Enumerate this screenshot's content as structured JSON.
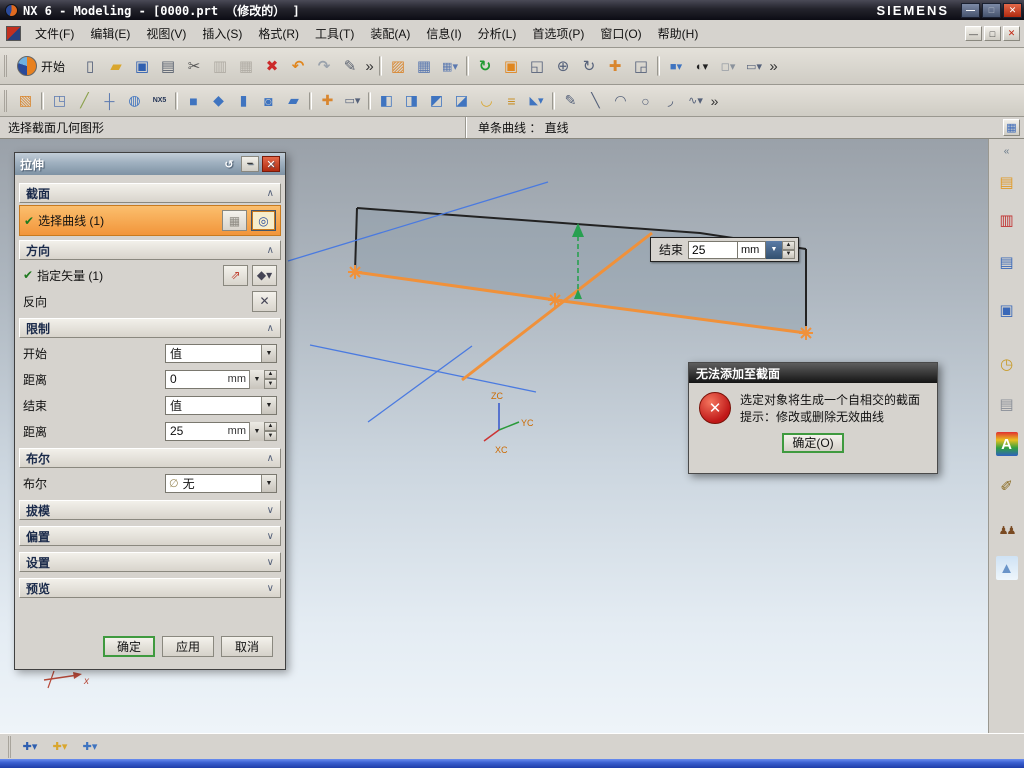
{
  "titlebar": {
    "title": "NX 6 - Modeling - [0000.prt （修改的） ]",
    "brand": "SIEMENS"
  },
  "window_buttons": {
    "min": "—",
    "max": "□",
    "close": "✕"
  },
  "glyphs": {
    "down": "▼",
    "up": "▲",
    "chev_up": "∧",
    "chev_down": "∨",
    "check": "✔",
    "reset": "↺",
    "minus": "−",
    "close": "✕",
    "loop": "◎",
    "vector_dialog": "⇗",
    "vector_list": "◆▾",
    "reverse": "✕",
    "deselect": "▦",
    "none_icon": "∅",
    "prompt_btn": "▦",
    "error_x": "✕"
  },
  "menubar": {
    "items": [
      "文件(F)",
      "编辑(E)",
      "视图(V)",
      "插入(S)",
      "格式(R)",
      "工具(T)",
      "装配(A)",
      "信息(I)",
      "分析(L)",
      "首选项(P)",
      "窗口(O)",
      "帮助(H)"
    ]
  },
  "toolbar1": {
    "start_label": "开始",
    "icons": [
      {
        "name": "new-file-icon",
        "g": "▯",
        "style": "color:#55617a"
      },
      {
        "name": "open-folder-icon",
        "g": "▰",
        "style": "color:#d9a62e"
      },
      {
        "name": "save-icon",
        "g": "▣",
        "style": "color:#2f5fb0"
      },
      {
        "name": "print-icon",
        "g": "▤",
        "style": "color:#5a6270"
      },
      {
        "name": "cut-icon",
        "g": "✂",
        "style": "color:#555555"
      },
      {
        "name": "copy-icon",
        "g": "▥",
        "style": "color:#b0aca4"
      },
      {
        "name": "paste-icon",
        "g": "▦",
        "style": "color:#b0aca4"
      },
      {
        "name": "delete-icon",
        "g": "✖",
        "style": "color:#cc2a2a"
      },
      {
        "name": "undo-icon",
        "g": "↶",
        "style": "color:#e0861e;font-weight:bold"
      },
      {
        "name": "redo-icon",
        "g": "↷",
        "style": "color:#9aa2ac;font-weight:bold"
      },
      {
        "name": "pen-icon",
        "g": "✎",
        "style": "color:#5a6270"
      },
      {
        "name": "overflow-chevron-icon",
        "g": "»",
        "style": "color:#333333;width:11px"
      },
      {
        "name": "toolbar-separator",
        "g": "",
        "style": "width:3px;height:20px;margin:0 3px;border-left:1px solid #9a9890;border-right:1px solid #ffffff",
        "it": "false"
      },
      {
        "name": "sketch-task-icon",
        "g": "▨",
        "style": "color:#d9862e"
      },
      {
        "name": "datum-grid-icon",
        "g": "▦",
        "style": "color:#5b79b0"
      },
      {
        "name": "csys-grid-icon",
        "g": "▦▾",
        "style": "color:#5b79b0;font-size:11px"
      },
      {
        "name": "toolbar-separator",
        "g": "",
        "style": "width:3px;height:20px;margin:0 3px;border-left:1px solid #9a9890;border-right:1px solid #ffffff",
        "it": "false"
      },
      {
        "name": "refresh-icon",
        "g": "↻",
        "style": "color:#1f9a2f;font-weight:bold"
      },
      {
        "name": "fit-view-icon",
        "g": "▣",
        "style": "color:#e0861e"
      },
      {
        "name": "zoom-box-icon",
        "g": "◱",
        "style": "color:#55617a"
      },
      {
        "name": "zoom-in-out-icon",
        "g": "⊕",
        "style": "color:#55617a"
      },
      {
        "name": "rotate-view-icon",
        "g": "↻",
        "style": "color:#55617a"
      },
      {
        "name": "pan-view-icon",
        "g": "✚",
        "style": "color:#d9862e"
      },
      {
        "name": "snapshot-icon",
        "g": "◲",
        "style": "color:#55617a"
      },
      {
        "name": "toolbar-separator",
        "g": "",
        "style": "width:3px;height:20px;margin:0 3px;border-left:1px solid #9a9890;border-right:1px solid #ffffff",
        "it": "false"
      },
      {
        "name": "shaded-view-icon",
        "g": "■▾",
        "style": "color:#3f74c0;font-size:11px"
      },
      {
        "name": "render-style-icon",
        "g": "◐▾",
        "style": "color:#222222;font-size:11px"
      },
      {
        "name": "background-icon",
        "g": "◻▾",
        "style": "color:#8a929c;font-size:11px"
      },
      {
        "name": "window-display-icon",
        "g": "▭▾",
        "style": "color:#55617a;font-size:11px"
      },
      {
        "name": "overflow-chevron-icon",
        "g": "»",
        "style": "color:#333333;width:11px"
      }
    ]
  },
  "toolbar2": {
    "icons": [
      {
        "name": "direct-sketch-icon",
        "g": "▧",
        "style": "color:#d9862e"
      },
      {
        "name": "toolbar-separator",
        "g": "",
        "style": "width:3px;height:18px;margin:0 3px;border-left:1px solid #9a9890;border-right:1px solid #ffffff",
        "it": "false"
      },
      {
        "name": "datum-plane-icon",
        "g": "◳",
        "style": "color:#5b79b0"
      },
      {
        "name": "datum-axis-icon",
        "g": "╱",
        "style": "color:#8aa04a"
      },
      {
        "name": "datum-csys-icon",
        "g": "┼",
        "style": "color:#5b79b0"
      },
      {
        "name": "cylinder-icon",
        "g": "◍",
        "style": "color:#3f74c0"
      },
      {
        "name": "nx5-sketch-icon",
        "g": "NX5",
        "style": "color:#223355;font-size:7px;font-weight:bold"
      },
      {
        "name": "toolbar-separator",
        "g": "",
        "style": "width:3px;height:18px;margin:0 3px;border-left:1px solid #9a9890;border-right:1px solid #ffffff",
        "it": "false"
      },
      {
        "name": "extrude-icon",
        "g": "■",
        "style": "color:#3f74c0"
      },
      {
        "name": "revolve-icon",
        "g": "◆",
        "style": "color:#3f74c0"
      },
      {
        "name": "block-icon",
        "g": "▮",
        "style": "color:#3f74c0"
      },
      {
        "name": "hole-icon",
        "g": "◙",
        "style": "color:#3f74c0"
      },
      {
        "name": "boss-icon",
        "g": "▰",
        "style": "color:#3f74c0"
      },
      {
        "name": "toolbar-separator",
        "g": "",
        "style": "width:3px;height:18px;margin:0 3px;border-left:1px solid #9a9890;border-right:1px solid #ffffff",
        "it": "false"
      },
      {
        "name": "point-icon",
        "g": "✚",
        "style": "color:#d9862e"
      },
      {
        "name": "rectangle-icon",
        "g": "▭▾",
        "style": "color:#55617a;font-size:11px"
      },
      {
        "name": "toolbar-separator",
        "g": "",
        "style": "width:3px;height:18px;margin:0 3px;border-left:1px solid #9a9890;border-right:1px solid #ffffff",
        "it": "false"
      },
      {
        "name": "unite-icon",
        "g": "◧",
        "style": "color:#3f74c0"
      },
      {
        "name": "subtract-icon",
        "g": "◨",
        "style": "color:#3f74c0"
      },
      {
        "name": "intersect-icon",
        "g": "◩",
        "style": "color:#3f74c0"
      },
      {
        "name": "trim-body-icon",
        "g": "◪",
        "style": "color:#3f74c0"
      },
      {
        "name": "shell-icon",
        "g": "◡",
        "style": "color:#d9a62e;font-weight:bold"
      },
      {
        "name": "thread-icon",
        "g": "≡",
        "style": "color:#c89028"
      },
      {
        "name": "chamfer-icon",
        "g": "◣▾",
        "style": "color:#3f74c0;font-size:11px"
      },
      {
        "name": "toolbar-separator",
        "g": "",
        "style": "width:3px;height:18px;margin:0 3px;border-left:1px solid #9a9890;border-right:1px solid #ffffff",
        "it": "false"
      },
      {
        "name": "profile-icon",
        "g": "✎",
        "style": "color:#55617a"
      },
      {
        "name": "line-icon",
        "g": "╲",
        "style": "color:#55617a"
      },
      {
        "name": "arc-icon",
        "g": "◠",
        "style": "color:#55617a"
      },
      {
        "name": "circle-icon",
        "g": "○",
        "style": "color:#55617a"
      },
      {
        "name": "fillet-icon",
        "g": "◞",
        "style": "color:#55617a"
      },
      {
        "name": "spline-icon",
        "g": "∿▾",
        "style": "color:#55617a;font-size:11px"
      },
      {
        "name": "overflow-chevron-icon",
        "g": "»",
        "style": "color:#333333;width:11px"
      }
    ]
  },
  "promptbar": {
    "message": "选择截面几何图形",
    "filter": "单条曲线 ： 直线"
  },
  "dialog": {
    "title": "拉伸",
    "section_header": "截面",
    "select_curve": "选择曲线 (1)",
    "direction_header": "方向",
    "specify_vector": "指定矢量 (1)",
    "reverse_label": "反向",
    "limits_header": "限制",
    "start_label": "开始",
    "end_label": "结束",
    "distance_label": "距离",
    "value_option": "值",
    "start_distance": "0",
    "end_distance": "25",
    "unit": "mm",
    "boolean_header": "布尔",
    "boolean_label": "布尔",
    "boolean_value": "无",
    "draft_header": "拔模",
    "offset_header": "偏置",
    "settings_header": "设置",
    "preview_header": "预览",
    "ok": "确定",
    "apply": "应用",
    "cancel": "取消"
  },
  "floating": {
    "label": "结束",
    "value": "25",
    "unit": "mm"
  },
  "error_dialog": {
    "title": "无法添加至截面",
    "line1": "选定对象将生成一个自相交的截面",
    "line2": "提示：修改或删除无效曲线",
    "ok": "确定(O)"
  },
  "graphics": {
    "zc": "ZC",
    "yc": "YC",
    "xc": "XC",
    "x_label": "x"
  },
  "sidebar": {
    "icons": [
      {
        "name": "sidebar-grip",
        "g": "«",
        "style": "color:#667788;font-size:10px;height:13px;margin-top:2px"
      },
      {
        "name": "assembly-navigator-icon",
        "g": "▤",
        "style": "color:#e09a28;margin-top:12px"
      },
      {
        "name": "constraint-navigator-icon",
        "g": "▥",
        "style": "color:#c03030;margin-top:14px"
      },
      {
        "name": "part-navigator-icon",
        "g": "▤",
        "style": "color:#3a68b8;margin-top:18px"
      },
      {
        "name": "reuse-library-icon",
        "g": "▣",
        "style": "color:#3a68b8;margin-top:24px"
      },
      {
        "name": "history-icon",
        "g": "◷",
        "style": "color:#c89b28;margin-top:30px"
      },
      {
        "name": "notes-icon",
        "g": "▤",
        "style": "color:#8a8f98;margin-top:16px"
      },
      {
        "name": "palette-icon",
        "g": "A",
        "style": "background:linear-gradient(180deg,#e03030,#e8c020,#30a040,#3060c0);color:#ffffff;font-weight:bold;margin-top:16px;border-radius:2px;width:22px"
      },
      {
        "name": "tools-icon",
        "g": "✐",
        "style": "color:#8a6a20;margin-top:18px"
      },
      {
        "name": "roles-icon",
        "g": "♟♟",
        "style": "color:#7a4a22;font-size:11px;letter-spacing:-2px;margin-top:20px"
      },
      {
        "name": "scenes-icon",
        "g": "▲",
        "style": "color:#6a94c8;background:linear-gradient(180deg,#cfe2f4,#eef6fc);margin-top:14px;border-radius:2px;width:22px"
      }
    ]
  },
  "bottombar": {
    "icons": [
      {
        "name": "snap-point-icon",
        "g": "✚▾",
        "style": "color:#2f5fb0;font-size:11px"
      },
      {
        "name": "snap-end-point-icon",
        "g": "✚▾",
        "style": "color:#d9a62e;font-size:11px"
      },
      {
        "name": "snap-mid-point-icon",
        "g": "✚▾",
        "style": "color:#3f74c0;font-size:11px"
      }
    ]
  },
  "colors": {
    "accent_orange": "#f0913a",
    "selection_orange": "#f2953a",
    "ok_green": "#3f9a3f",
    "error_red": "#c01818",
    "blue_line": "#4a7ae0",
    "green_vector": "#28a050",
    "taskbar_blue": "#2243b8"
  }
}
